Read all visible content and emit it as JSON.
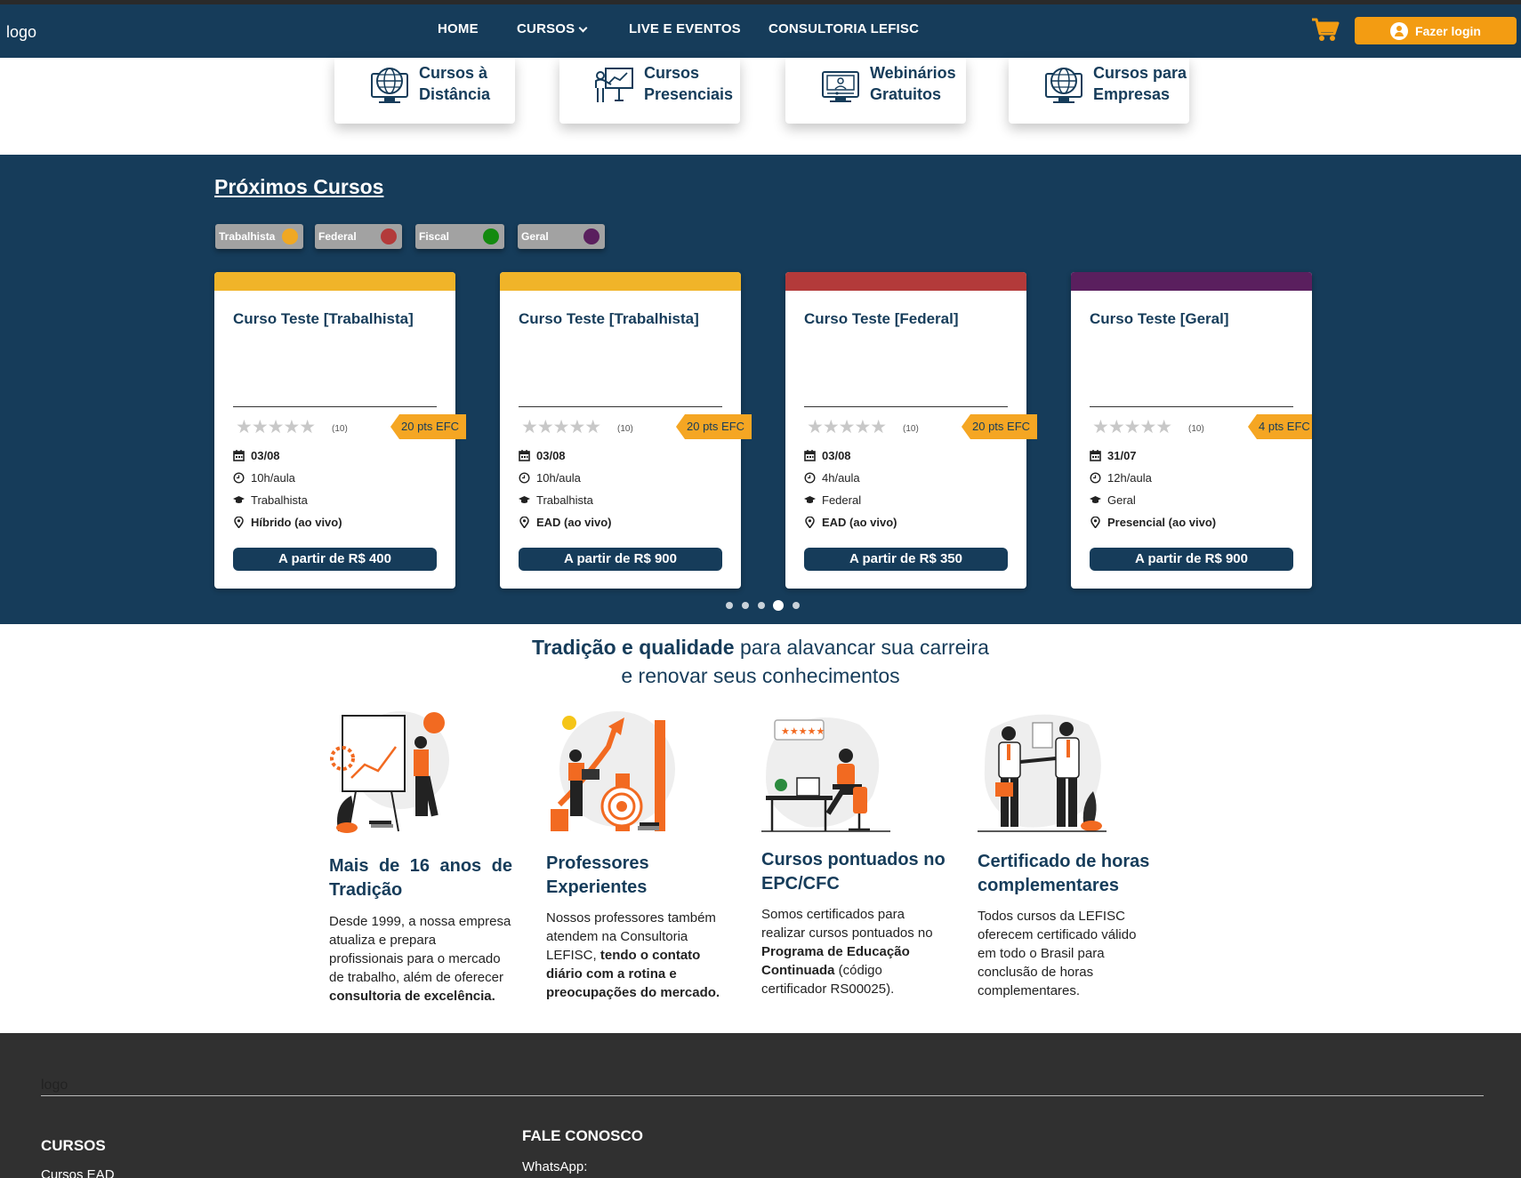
{
  "header": {
    "logo": "logo",
    "nav": [
      {
        "label": "HOME"
      },
      {
        "label": "CURSOS"
      },
      {
        "label": "LIVE E EVENTOS"
      },
      {
        "label": "CONSULTORIA LEFISC"
      }
    ],
    "login_label": "Fazer login",
    "cart_icon": "cart-icon",
    "accent": "#f39c12",
    "brand": "#163c5a"
  },
  "categories": [
    {
      "line1": "Cursos à",
      "line2": "Distância",
      "icon": "globe-monitor-icon"
    },
    {
      "line1": "Cursos",
      "line2": "Presenciais",
      "icon": "teacher-board-icon"
    },
    {
      "line1": "Webinários",
      "line2": "Gratuitos",
      "icon": "video-monitor-icon"
    },
    {
      "line1": "Cursos para",
      "line2": "Empresas",
      "icon": "globe-monitor-icon"
    }
  ],
  "upcoming": {
    "title": "Próximos Cursos",
    "filters": [
      {
        "label": "Trabalhista",
        "color": "#f0a824"
      },
      {
        "label": "Federal",
        "color": "#b33a3a"
      },
      {
        "label": "Fiscal",
        "color": "#138a0f"
      },
      {
        "label": "Geral",
        "color": "#5a1f5e"
      }
    ],
    "cards": [
      {
        "title": "Curso Teste [Trabalhista]",
        "color": "#f0b429",
        "stars": "★★★★★",
        "reviews": "(10)",
        "pts": "20 pts EFC",
        "date": "03/08",
        "hours": "10h/aula",
        "area": "Trabalhista",
        "mode": "Híbrido (ao vivo)",
        "price": "A partir de R$ 400"
      },
      {
        "title": "Curso Teste [Trabalhista]",
        "color": "#f0b429",
        "stars": "★★★★★",
        "reviews": "(10)",
        "pts": "20 pts EFC",
        "date": "03/08",
        "hours": "10h/aula",
        "area": "Trabalhista",
        "mode": "EAD (ao vivo)",
        "price": "A partir de R$ 900"
      },
      {
        "title": "Curso Teste [Federal]",
        "color": "#b33a3a",
        "stars": "★★★★★",
        "reviews": "(10)",
        "pts": "20 pts EFC",
        "date": "03/08",
        "hours": "4h/aula",
        "area": "Federal",
        "mode": "EAD (ao vivo)",
        "price": "A partir de R$ 350"
      },
      {
        "title": "Curso Teste [Geral]",
        "color": "#5a1f5e",
        "stars": "★★★★★",
        "reviews": "(10)",
        "pts": "4 pts EFC",
        "date": "31/07",
        "hours": "12h/aula",
        "area": "Geral",
        "mode": "Presencial (ao vivo)",
        "price": "A partir de R$ 900"
      }
    ],
    "carousel_dots": 5,
    "active_dot": 4
  },
  "tradition": {
    "headline_bold": "Tradição e qualidade",
    "headline_rest": " para alavancar sua carreira",
    "headline_line2": "e renovar seus conhecimentos",
    "features": [
      {
        "title": "Mais de 16 anos de Tradição",
        "text_plain": "Desde 1999, a nossa empresa atualiza e prepara profissionais para o mercado de trabalho, além de oferecer ",
        "text_bold": "consultoria de excelência.",
        "text_tail": ""
      },
      {
        "title": "Professores Experientes",
        "text_plain": "Nossos professores também atendem na Consultoria LEFISC, ",
        "text_bold": "tendo o contato diário com a rotina e preocupações do mercado.",
        "text_tail": ""
      },
      {
        "title": "Cursos pontuados no EPC/CFC",
        "text_plain": "Somos certificados para realizar cursos pontuados no ",
        "text_bold": "Programa de Educação Continuada",
        "text_tail": " (código certificador RS00025)."
      },
      {
        "title": "Certificado de horas complementares",
        "text_plain": "Todos cursos da LEFISC oferecem certificado válido em todo o Brasil para conclusão de horas complementares.",
        "text_bold": "",
        "text_tail": ""
      }
    ]
  },
  "footer": {
    "logo": "logo",
    "courses_heading": "CURSOS",
    "courses_first": "Cursos EAD",
    "contact_heading": "FALE CONOSCO",
    "contact_first": "WhatsApp:"
  }
}
